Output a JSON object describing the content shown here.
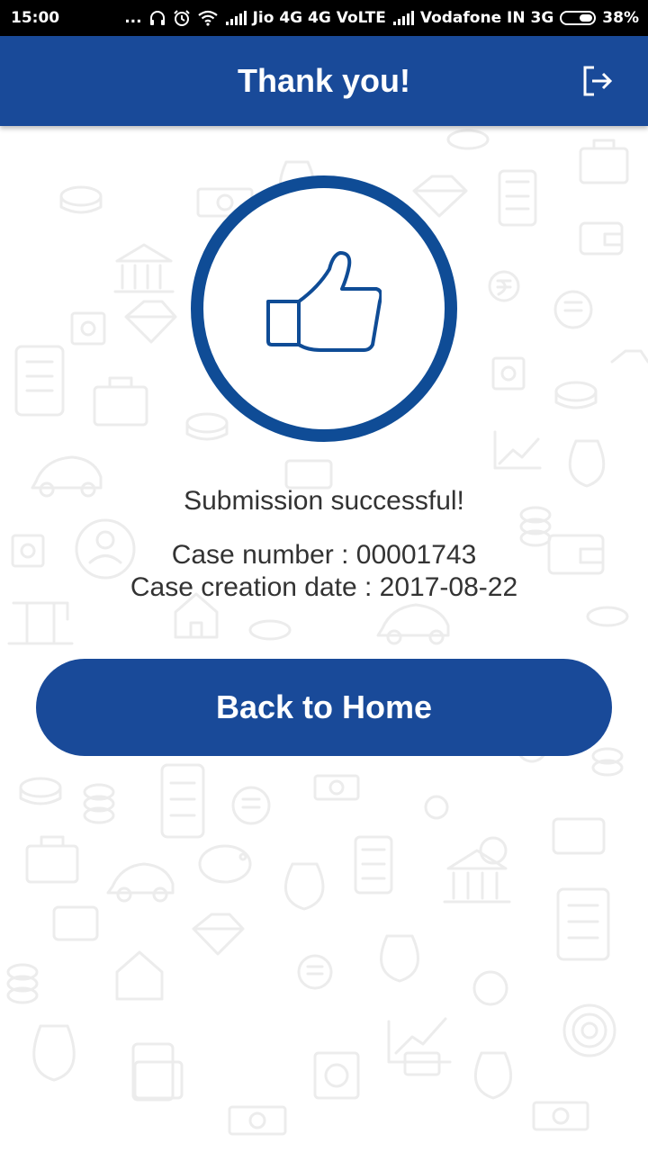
{
  "status_bar": {
    "time": "15:00",
    "dots": "...",
    "carrier1": "Jio 4G 4G VoLTE",
    "carrier2": "Vodafone IN 3G",
    "battery_percent": "38%",
    "battery_level": 0.38
  },
  "header": {
    "title": "Thank you!",
    "logout_icon": "logout-icon"
  },
  "main": {
    "icon": "thumbs-up-icon",
    "message": "Submission successful!",
    "case_number_line": "Case number : 00001743",
    "case_date_line": "Case creation date : 2017-08-22",
    "button_label": "Back to Home"
  },
  "colors": {
    "primary": "#194a99",
    "circle": "#0f4c96",
    "text": "#333333"
  }
}
